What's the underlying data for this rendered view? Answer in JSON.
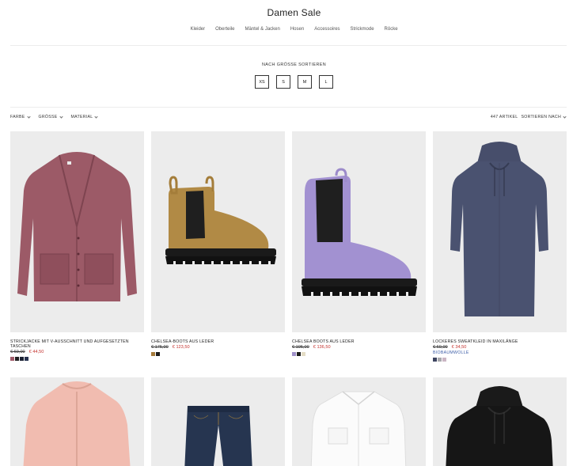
{
  "header": {
    "title": "Damen Sale"
  },
  "categories": [
    "Kleider",
    "Oberteile",
    "Mäntel & Jacken",
    "Hosen",
    "Accessoires",
    "Strickmode",
    "Röcke"
  ],
  "size_sort": {
    "title": "NACH GRÖSSE SORTIEREN",
    "sizes": [
      "XS",
      "S",
      "M",
      "L"
    ]
  },
  "filters": [
    "FARBE",
    "GRÖSSE",
    "MATERIAL"
  ],
  "toolbar": {
    "count": "447 ARTIKEL",
    "sort_label": "SORTIEREN NACH"
  },
  "products": [
    {
      "name": "STRICKJACKE MIT V-AUSSCHNITT UND AUFGESETZTEN TASCHEN",
      "old_price": "€ 69,00",
      "new_price": "€ 44,50",
      "tag": "",
      "icon": "cardigan-image",
      "swatches": [
        "#a05b69",
        "#1f1f1f",
        "#1b2233",
        "#27324f"
      ]
    },
    {
      "name": "CHELSEA-BOOTS AUS LEDER",
      "old_price": "€ 175,00",
      "new_price": "€ 123,50",
      "tag": "",
      "icon": "tan-boot-image",
      "swatches": [
        "#a57a3a",
        "#1d1d1d"
      ]
    },
    {
      "name": "CHELSEA BOOTS AUS LEDER",
      "old_price": "€ 195,00",
      "new_price": "€ 136,50",
      "tag": "",
      "icon": "lilac-boot-image",
      "swatches": [
        "#9f90c9",
        "#1d1d1d",
        "#e4dcc5"
      ]
    },
    {
      "name": "LOCKERES SWEATKLEID IN MAXILÄNGE",
      "old_price": "€ 69,00",
      "new_price": "€ 34,50",
      "tag": "BIOBAUMWOLLE",
      "icon": "hoodie-dress-image",
      "swatches": [
        "#3e4560",
        "#a9a9ad",
        "#cbb6c4"
      ]
    },
    {
      "icon": "pink-jacket-image"
    },
    {
      "icon": "jeans-image"
    },
    {
      "icon": "white-shirt-image"
    },
    {
      "icon": "black-hoodie-image"
    }
  ]
}
